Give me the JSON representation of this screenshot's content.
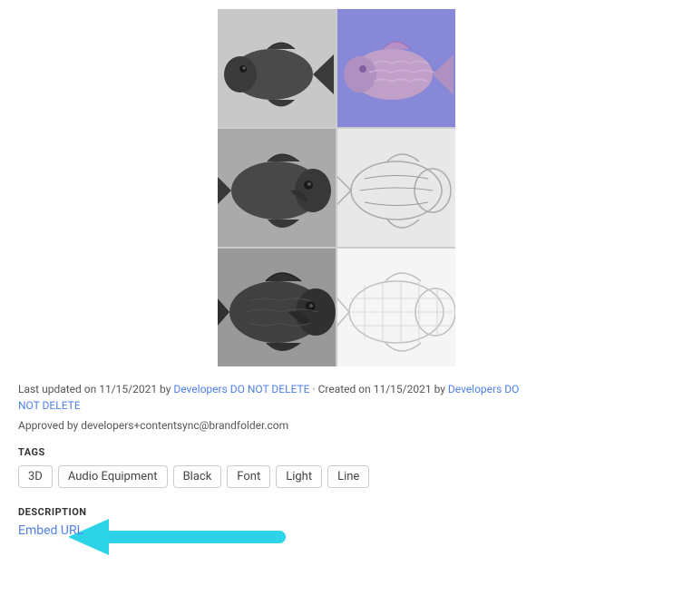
{
  "image": {
    "alt": "3D fish model texture views"
  },
  "metadata": {
    "last_updated_prefix": "Last updated on ",
    "last_updated_date": "11/15/2021",
    "by_text": " by ",
    "author_link1": "Developers DO NOT DELETE",
    "created_prefix": " · Created on ",
    "created_date": "11/15/2021",
    "by_text2": " by ",
    "author_link2": "Developers DO NOT DELETE",
    "approved_prefix": "Approved by ",
    "approved_email": "developers+contentsync@brandfolder.com"
  },
  "tags": {
    "label": "TAGS",
    "items": [
      "3D",
      "Audio Equipment",
      "Black",
      "Font",
      "Light",
      "Line"
    ]
  },
  "description": {
    "label": "DESCRIPTION",
    "embed_url_text": "Embed URL"
  },
  "colors": {
    "link": "#5080e8",
    "tag_border": "#cccccc",
    "arrow": "#2dd4e8"
  }
}
